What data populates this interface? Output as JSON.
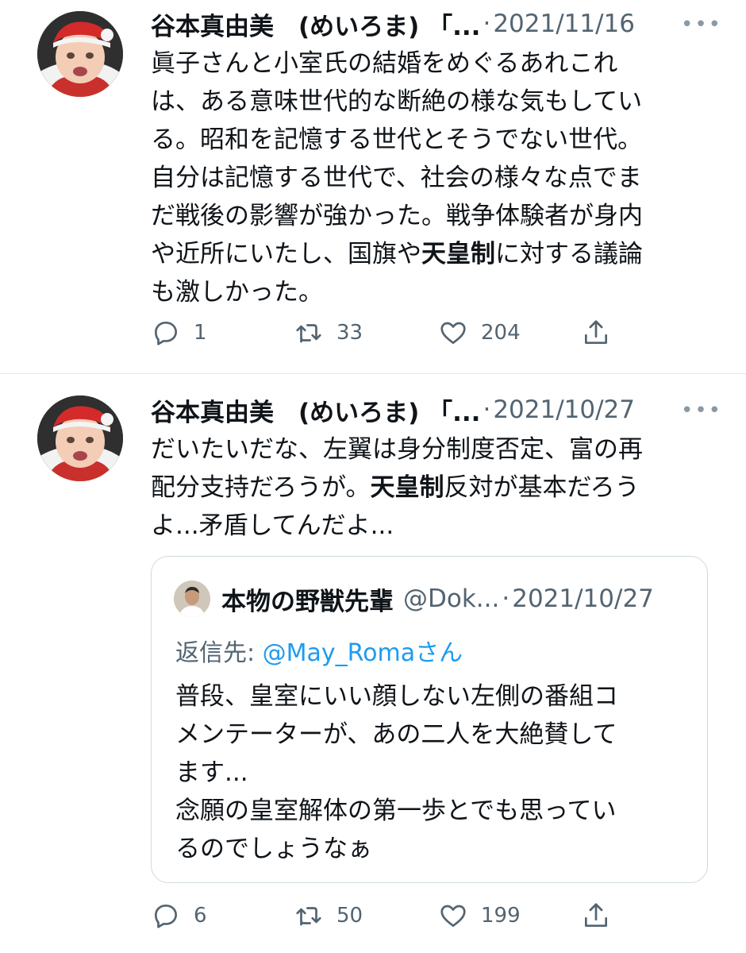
{
  "tweets": [
    {
      "author_name": "谷本真由美　(めいろま) 「...",
      "separator": "·",
      "date": "2021/11/16",
      "more_label": "•••",
      "body_lines": [
        {
          "text": "眞子さんと小室氏の結婚をめぐるあれこれ"
        },
        {
          "text": "は、ある意味世代的な断絶の様な気もしてい"
        },
        {
          "text": "る。昭和を記憶する世代とそうでない世代。"
        },
        {
          "text": "自分は記憶する世代で、社会の様々な点でま"
        },
        {
          "text": "だ戦後の影響が強かった。戦争体験者が身内"
        },
        {
          "pre": "や近所にいたし、国旗や",
          "bold": "天皇制",
          "post": "に対する議論"
        },
        {
          "text": "も激しかった。"
        }
      ],
      "stats": {
        "replies": "1",
        "retweets": "33",
        "likes": "204"
      }
    },
    {
      "author_name": "谷本真由美　(めいろま) 「...",
      "separator": "·",
      "date": "2021/10/27",
      "more_label": "•••",
      "body_lines": [
        {
          "text": "だいたいだな、左翼は身分制度否定、富の再"
        },
        {
          "pre": "配分支持だろうが。",
          "bold": "天皇制",
          "post": "反対が基本だろう"
        },
        {
          "text": "よ...矛盾してんだよ..."
        }
      ],
      "stats": {
        "replies": "6",
        "retweets": "50",
        "likes": "199"
      },
      "quoted": {
        "author_name": "本物の野獣先輩",
        "handle": "@Dok...",
        "separator": "·",
        "date": "2021/10/27",
        "reply_prefix": "返信先: ",
        "reply_mention": "@May_Roma",
        "reply_suffix": "さん",
        "body_lines": [
          "普段、皇室にいい顔しない左側の番組コ",
          "メンテーターが、あの二人を大絶賛して",
          "ます...",
          "念願の皇室解体の第一歩とでも思ってい",
          "るのでしょうなぁ"
        ]
      }
    }
  ],
  "icons": {
    "reply": "reply-icon",
    "retweet": "retweet-icon",
    "like": "heart-icon",
    "share": "share-icon",
    "avatar": "baby-santa-hat-avatar"
  },
  "colors": {
    "text": "#0f1419",
    "muted": "#536471",
    "link": "#1d9bf0",
    "border": "#cfd9de"
  }
}
